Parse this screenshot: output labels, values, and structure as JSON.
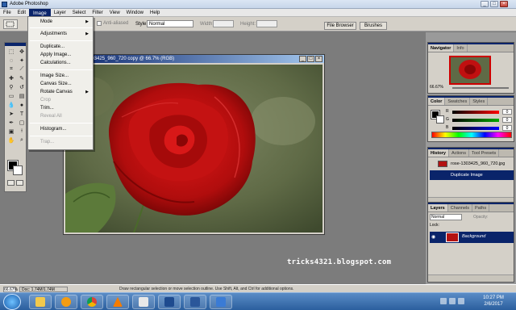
{
  "window": {
    "title": "Adobe Photoshop",
    "controls": {
      "minimize": "_",
      "maximize": "□",
      "close": "×"
    }
  },
  "menubar": {
    "items": [
      "File",
      "Edit",
      "Image",
      "Layer",
      "Select",
      "Filter",
      "View",
      "Window",
      "Help"
    ],
    "active": "Image"
  },
  "options_bar": {
    "anti_aliased": "Anti-aliased",
    "style_label": "Style:",
    "style_value": "Normal",
    "width_label": "Width:",
    "height_label": "Height:",
    "file_browser_tab": "File Browser",
    "brushes_tab": "Brushes"
  },
  "image_menu": {
    "items": [
      {
        "label": "Mode",
        "submenu": true,
        "enabled": true
      },
      {
        "label": "Adjustments",
        "submenu": true,
        "enabled": true
      },
      {
        "label": "Duplicate...",
        "submenu": false,
        "enabled": true
      },
      {
        "label": "Apply Image...",
        "submenu": false,
        "enabled": true
      },
      {
        "label": "Calculations...",
        "submenu": false,
        "enabled": true
      },
      {
        "label": "Image Size...",
        "submenu": false,
        "enabled": true
      },
      {
        "label": "Canvas Size...",
        "submenu": false,
        "enabled": true
      },
      {
        "label": "Rotate Canvas",
        "submenu": true,
        "enabled": true
      },
      {
        "label": "Crop",
        "submenu": false,
        "enabled": false
      },
      {
        "label": "Trim...",
        "submenu": false,
        "enabled": true
      },
      {
        "label": "Reveal All",
        "submenu": false,
        "enabled": false
      },
      {
        "label": "Histogram...",
        "submenu": false,
        "enabled": true
      },
      {
        "label": "Trap...",
        "submenu": false,
        "enabled": false
      }
    ]
  },
  "document": {
    "title": "rose-1303425_960_720 copy @ 66.7% (RGB)"
  },
  "panels": {
    "navigator": {
      "tabs": [
        "Navigator",
        "Info"
      ],
      "zoom": "66.67%"
    },
    "color": {
      "tabs": [
        "Color",
        "Swatches",
        "Styles"
      ],
      "channels": [
        {
          "label": "R",
          "value": "0",
          "color": "#ff0000"
        },
        {
          "label": "G",
          "value": "0",
          "color": "#00aa00"
        },
        {
          "label": "B",
          "value": "0",
          "color": "#0000ff"
        }
      ]
    },
    "history": {
      "tabs": [
        "History",
        "Actions",
        "Tool Presets"
      ],
      "snapshot": "rose-1303425_960_720.jpg",
      "steps": [
        "Duplicate Image"
      ]
    },
    "layers": {
      "tabs": [
        "Layers",
        "Channels",
        "Paths"
      ],
      "blend_mode": "Normal",
      "opacity_label": "Opacity:",
      "lock_label": "Lock:",
      "layer_name": "Background"
    }
  },
  "statusbar": {
    "zoom": "66.67%",
    "doc": "Doc: 1.74M/1.74M",
    "hint": "Draw rectangular selection or move selection outline. Use Shift, Alt, and Ctrl for additional options."
  },
  "watermark": "tricks4321.blogspot.com",
  "taskbar": {
    "time": "10:27 PM",
    "date": "2/6/2017",
    "apps": [
      "explorer-icon",
      "media-player-icon",
      "chrome-icon",
      "vlc-icon",
      "paint-icon",
      "photoshop-icon",
      "word-icon",
      "explorer-icon-2"
    ]
  }
}
